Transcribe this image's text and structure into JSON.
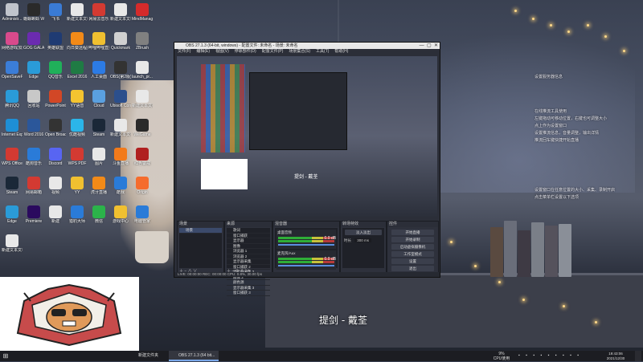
{
  "desktop": {
    "icons": [
      {
        "label": "Administr...",
        "color": "#c0c4cc"
      },
      {
        "label": "蟾蜍蝌蚪 WeGame版",
        "color": "#2a2a2a"
      },
      {
        "label": "飞书",
        "color": "#3a7bd5"
      },
      {
        "label": "新建文本文档 (1).txt",
        "color": "#e8e8e8"
      },
      {
        "label": "网易云音乐",
        "color": "#d33a32"
      },
      {
        "label": "新建文本文档 (3).txt",
        "color": "#e8e8e8"
      },
      {
        "label": "MindManager",
        "color": "#d52b2b"
      },
      {
        "label": "网络游戏加速 工具",
        "color": "#d94a8c"
      },
      {
        "label": "GOG GALAXY",
        "color": "#6b2bb0"
      },
      {
        "label": "英雄联盟",
        "color": "#1f3b73"
      },
      {
        "label": "向日葵远程控制",
        "color": "#f28a18"
      },
      {
        "label": "哔哩哔哩直播姬",
        "color": "#f0c030"
      },
      {
        "label": "Quickmark",
        "color": "#d0d0d0"
      },
      {
        "label": "ZBrush",
        "color": "#808080"
      },
      {
        "label": "OpenSavePro",
        "color": "#3b7dd8"
      },
      {
        "label": "Edge",
        "color": "#2a9bd8"
      },
      {
        "label": "QQ音乐",
        "color": "#20b05a"
      },
      {
        "label": "Excel 2016",
        "color": "#1f7b44"
      },
      {
        "label": "人工桌面",
        "color": "#2c7be5"
      },
      {
        "label": "OBS(第2版)",
        "color": "#333333"
      },
      {
        "label": "launch_pr...",
        "color": "#e8e8e8"
      },
      {
        "label": "腾讯QQ",
        "color": "#2a9bd8"
      },
      {
        "label": "回收站",
        "color": "#c8c8c8"
      },
      {
        "label": "PowerPoint",
        "color": "#d24726"
      },
      {
        "label": "YY语音",
        "color": "#f4c430"
      },
      {
        "label": "Cloud",
        "color": "#5aa0e0"
      },
      {
        "label": "Ubisoft Connect",
        "color": "#2b4f8c"
      },
      {
        "label": "新建文本文档 (5).txt",
        "color": "#e8e8e8"
      },
      {
        "label": "Internet Explorer",
        "color": "#1e8fd6"
      },
      {
        "label": "Word 2016",
        "color": "#2b579a"
      },
      {
        "label": "Open Broadcaster",
        "color": "#333333"
      },
      {
        "label": "优酷视频",
        "color": "#2bb5e8"
      },
      {
        "label": "Steam",
        "color": "#1b2838"
      },
      {
        "label": "新建文本文档",
        "color": "#e8e8e8"
      },
      {
        "label": "WeGame",
        "color": "#2a2a2a"
      },
      {
        "label": "WPS Office",
        "color": "#d33a32"
      },
      {
        "label": "酷狗音乐",
        "color": "#2a7bd8"
      },
      {
        "label": "Discord",
        "color": "#5865f2"
      },
      {
        "label": "WPS PDF",
        "color": "#d33a32"
      },
      {
        "label": "图片",
        "color": "#e8e8e8"
      },
      {
        "label": "斗鱼直播",
        "color": "#f27a1a"
      },
      {
        "label": "红色警戒",
        "color": "#b02020"
      },
      {
        "label": "Steam",
        "color": "#1b2838"
      },
      {
        "label": "网易邮箱",
        "color": "#d33a32"
      },
      {
        "label": "视频",
        "color": "#e8e8e8"
      },
      {
        "label": "YY",
        "color": "#f0c030"
      },
      {
        "label": "虎牙直播",
        "color": "#f28a18"
      },
      {
        "label": "酷我",
        "color": "#2a7bd8"
      },
      {
        "label": "Origin",
        "color": "#f56c2d"
      },
      {
        "label": "Edge",
        "color": "#2a9bd8"
      },
      {
        "label": "Premiere",
        "color": "#2a0a5e"
      },
      {
        "label": "新建",
        "color": "#e8e8e8"
      },
      {
        "label": "猎豹大师",
        "color": "#2a7bd8"
      },
      {
        "label": "微信",
        "color": "#2bb34a"
      },
      {
        "label": "游戏中心",
        "color": "#f0c030"
      },
      {
        "label": "电脑管家",
        "color": "#2a7bd8"
      },
      {
        "label": "新建文本文档 (2).txt",
        "color": "#e8e8e8"
      }
    ]
  },
  "obs": {
    "title": "OBS 27.1.3 (64-bit, windows) - 配置文件: 未命名 - 场景: 未命名",
    "menu": [
      "文件(F)",
      "编辑(E)",
      "视图(V)",
      "停靠部件(D)",
      "配置文件(P)",
      "场景集合(S)",
      "工具(T)",
      "帮助(H)"
    ],
    "preview_caption": "提剑 - 戴荃",
    "docks": {
      "scenes": {
        "title": "场景",
        "items": [
          "场景"
        ]
      },
      "sources": {
        "title": "来源",
        "items": [
          "歌词",
          "窗口捕获",
          "显示器",
          "图像",
          "浏览器 1",
          "浏览器 2",
          "显示器采集",
          "窗口捕获 2",
          "显示器采集 2",
          "图像 2",
          "颜色源",
          "显示器采集 3",
          "窗口捕获 3"
        ]
      },
      "mixer": {
        "title": "混音器",
        "channels": [
          {
            "name": "桌面音频",
            "level": "0.0 dB"
          },
          {
            "name": "麦克风/Aux",
            "level": "0.0 dB"
          }
        ]
      },
      "transitions": {
        "title": "转场特效",
        "type": "淡入淡出",
        "duration_label": "时长",
        "duration": "300 ms"
      },
      "controls": {
        "title": "控件",
        "buttons": [
          "开始直播",
          "开始录制",
          "启动虚拟摄像机",
          "工作室模式",
          "设置",
          "退出"
        ]
      }
    },
    "status": "LIVE: 00:00:00   REC: 00:00:00   CPU: 0.8%, 30.00 fps"
  },
  "notes": {
    "line1": "设置服务器信息",
    "line2": "设置服务器和推流码",
    "lines": [
      "在线推流工具使用",
      "左键拖动可移动位置，右键也可调整大小",
      "点上作为设置窗口",
      "设置推流信息，音量调整，输出详情",
      "推流回车键快捷开始直播"
    ],
    "lines2": [
      "设置窗口在任意位置的大小、采集、录制开启",
      "点击菜单栏设置以下选项"
    ]
  },
  "subtitle": "提剑 - 戴荃",
  "taskbar": {
    "items": [
      {
        "label": "新建文件夹"
      },
      {
        "label": "OBS 27.1.3 (64 bit..."
      }
    ],
    "cpu": "9%",
    "cpu_label": "CPU使用",
    "time": "19:43:06",
    "date": "2021/12/30"
  }
}
